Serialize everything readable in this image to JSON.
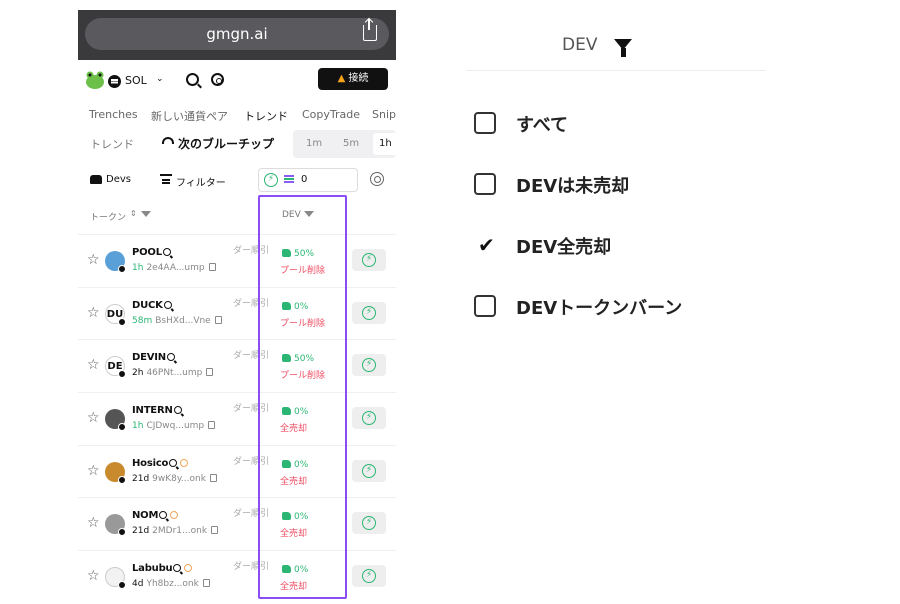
{
  "browser": {
    "url": "gmgn.ai"
  },
  "topnav": {
    "chain": "SOL",
    "connect_label": "接続",
    "warn_icon": "!"
  },
  "tabs": [
    "Trenches",
    "新しい通貨ペア",
    "トレンド",
    "CopyTrade",
    "Snip"
  ],
  "subnav": {
    "trend": "トレンド",
    "bluechip": "次のブルーチップ",
    "timeframes": [
      "1m",
      "5m",
      "1h"
    ],
    "active_timeframe": "1h"
  },
  "filterbar": {
    "devs_label": "Devs",
    "filter_label": "フィルター",
    "quickbuy_value": "0"
  },
  "table": {
    "col_token": "トークン",
    "col_dev": "DEV",
    "mid_label": "ダー順引",
    "rows": [
      {
        "symbol": "POOL",
        "age": "1h",
        "addr": "2e4AA...ump",
        "dev_pct": "50%",
        "dev_status": "プール削除",
        "avatar_text": "",
        "avatar_color": "#5aa0d8",
        "age_green": true,
        "ext": false
      },
      {
        "symbol": "DUCK",
        "age": "58m",
        "addr": "BsHXd...Vne",
        "dev_pct": "0%",
        "dev_status": "プール削除",
        "avatar_text": "DU",
        "avatar_color": "#ffffff",
        "age_green": true,
        "ext": false
      },
      {
        "symbol": "DEVIN",
        "age": "2h",
        "addr": "46PNt...ump",
        "dev_pct": "50%",
        "dev_status": "プール削除",
        "avatar_text": "DE",
        "avatar_color": "#ffffff",
        "age_green": false,
        "ext": false
      },
      {
        "symbol": "INTERN",
        "age": "1h",
        "addr": "CJDwq...ump",
        "dev_pct": "0%",
        "dev_status": "全売却",
        "avatar_text": "",
        "avatar_color": "#555555",
        "age_green": true,
        "ext": false
      },
      {
        "symbol": "Hosico",
        "age": "21d",
        "addr": "9wK8y...onk",
        "dev_pct": "0%",
        "dev_status": "全売却",
        "avatar_text": "",
        "avatar_color": "#c98a2d",
        "age_green": false,
        "ext": true
      },
      {
        "symbol": "NOM",
        "age": "21d",
        "addr": "2MDr1...onk",
        "dev_pct": "0%",
        "dev_status": "全売却",
        "avatar_text": "",
        "avatar_color": "#999999",
        "age_green": false,
        "ext": true
      },
      {
        "symbol": "Labubu",
        "age": "4d",
        "addr": "Yh8bz...onk",
        "dev_pct": "0%",
        "dev_status": "全売却",
        "avatar_text": "",
        "avatar_color": "#f2f2f2",
        "age_green": false,
        "ext": true
      }
    ]
  },
  "dropdown": {
    "title": "DEV",
    "options": [
      {
        "label": "すべて",
        "state": "unchecked"
      },
      {
        "label": "DEVは未売却",
        "state": "unchecked"
      },
      {
        "label": "DEV全売却",
        "state": "checked"
      },
      {
        "label": "DEVトークンバーン",
        "state": "unchecked"
      }
    ]
  },
  "colors": {
    "accent_purple": "#8b4cf6",
    "positive_green": "#2bb673",
    "negative_red": "#ee4e64"
  },
  "icons": {
    "share": "share-icon",
    "search": "search-icon",
    "gear": "gear-icon",
    "star": "☆",
    "bolt": "⚡",
    "check": "✔"
  }
}
